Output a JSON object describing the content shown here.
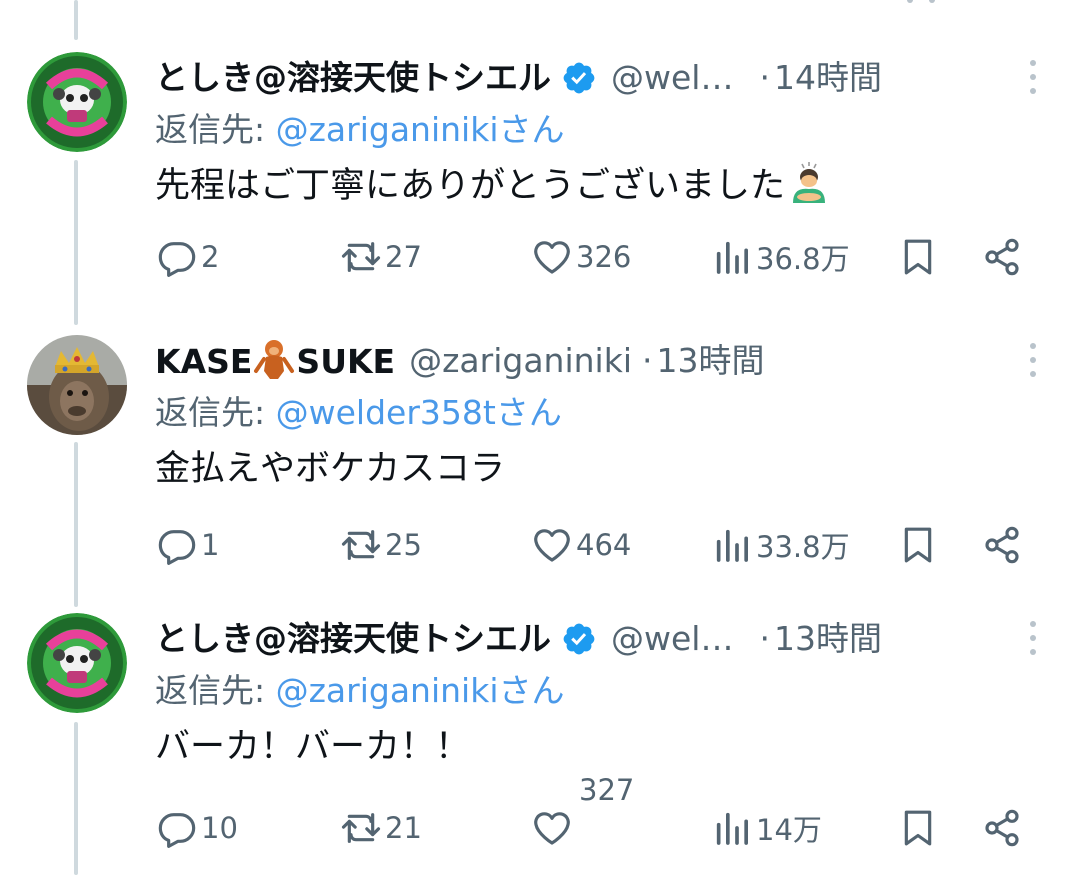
{
  "tweets": [
    {
      "display_name": "としき@溶接天使トシエル",
      "verified": true,
      "handle": "@wel…",
      "separator": "·",
      "time": "14時間",
      "reply_prefix": "返信先: ",
      "reply_to": "@zariganinikiさん",
      "text": "先程はご丁寧にありがとうございました",
      "emoji": "person-bowing-emoji",
      "avatar": "welder-358t-logo",
      "replies": "2",
      "retweets": "27",
      "likes": "326",
      "views": "36.8万"
    },
    {
      "display_name": "KASE🦧SUKE",
      "display_name_parts": [
        "KASE",
        "SUKE"
      ],
      "verified": false,
      "handle": "@zariganiniki",
      "separator": "·",
      "time": "13時間",
      "reply_prefix": "返信先: ",
      "reply_to": "@welder358tさん",
      "text": "金払えやボケカスコラ",
      "avatar": "crowned-monkey-photo",
      "replies": "1",
      "retweets": "25",
      "likes": "464",
      "views": "33.8万"
    },
    {
      "display_name": "としき@溶接天使トシエル",
      "verified": true,
      "handle": "@wel…",
      "separator": "·",
      "time": "13時間",
      "reply_prefix": "返信先: ",
      "reply_to": "@zariganinikiさん",
      "text": "バーカ！バーカ！！",
      "avatar": "welder-358t-logo",
      "replies": "10",
      "retweets": "21",
      "likes": "327",
      "views": "14万"
    }
  ],
  "colors": {
    "text": "#0f1419",
    "secondary": "#536471",
    "link": "#4a99e9",
    "verified": "#1d9bf0",
    "thread_line": "#cfd9de"
  },
  "icons": [
    "reply-icon",
    "retweet-icon",
    "like-icon",
    "views-icon",
    "bookmark-icon",
    "share-icon",
    "more-icon",
    "verified-badge-icon"
  ]
}
